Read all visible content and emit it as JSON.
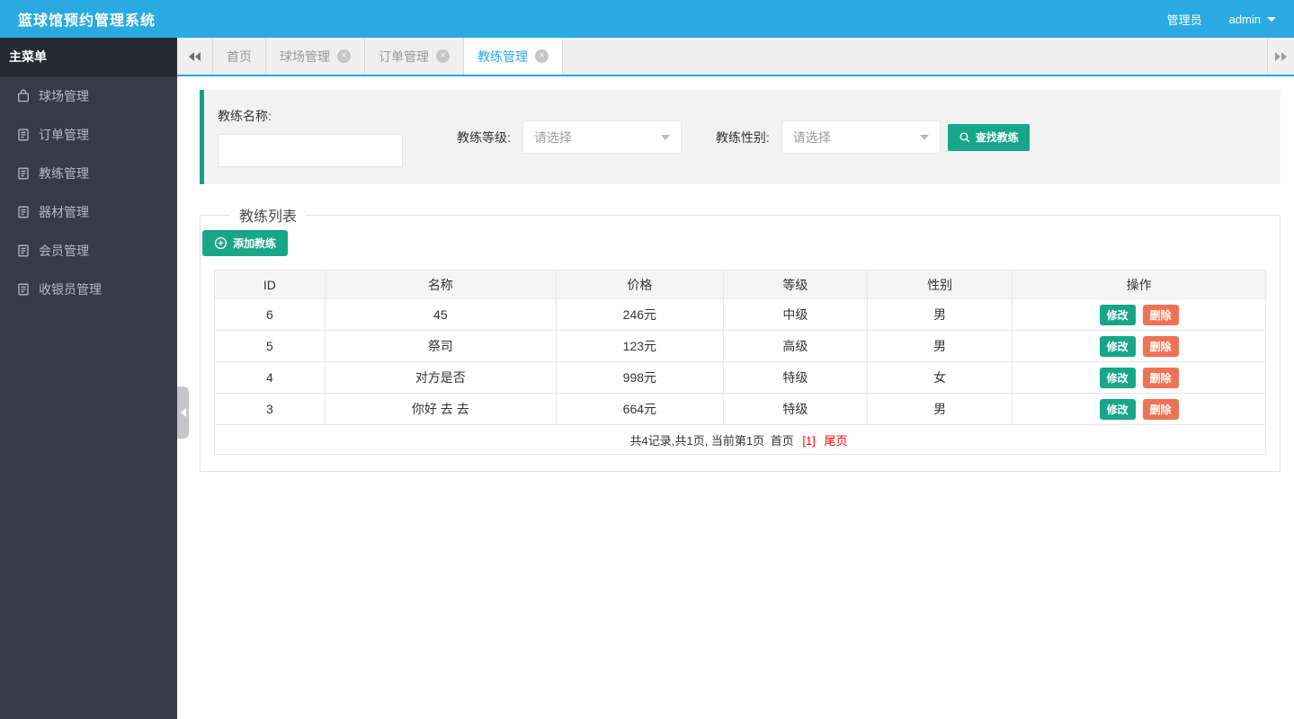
{
  "colors": {
    "accent_blue": "#29abe2",
    "teal_button": "#18a689",
    "teal_accent_bar": "#16a085",
    "orange_delete": "#ee7255",
    "pagination_red": "#ff0000",
    "sidebar_dark": "#373b47"
  },
  "header": {
    "title": "篮球馆预约管理系统",
    "role": "管理员",
    "username": "admin"
  },
  "sidebar": {
    "title": "主菜单",
    "items": [
      {
        "label": "球场管理",
        "icon": "bag-icon"
      },
      {
        "label": "订单管理",
        "icon": "doc-icon"
      },
      {
        "label": "教练管理",
        "icon": "doc-icon"
      },
      {
        "label": "器材管理",
        "icon": "doc-icon"
      },
      {
        "label": "会员管理",
        "icon": "doc-icon"
      },
      {
        "label": "收银员管理",
        "icon": "doc-icon"
      }
    ]
  },
  "tabbar": {
    "tabs": [
      {
        "label": "首页",
        "closable": false,
        "active": false
      },
      {
        "label": "球场管理",
        "closable": true,
        "active": false
      },
      {
        "label": "订单管理",
        "closable": true,
        "active": false
      },
      {
        "label": "教练管理",
        "closable": true,
        "active": true
      }
    ]
  },
  "search": {
    "name_label": "教练名称:",
    "name_value": "",
    "level_label": "教练等级:",
    "level_placeholder": "请选择",
    "gender_label": "教练性别:",
    "gender_placeholder": "请选择",
    "submit_label": "查找教练"
  },
  "coach_list": {
    "legend": "教练列表",
    "add_button_label": "添加教练",
    "table": {
      "columns": [
        "ID",
        "名称",
        "价格",
        "等级",
        "性别",
        "操作"
      ],
      "rows": [
        {
          "id": "6",
          "name": "45",
          "price": "246元",
          "level": "中级",
          "gender": "男"
        },
        {
          "id": "5",
          "name": "祭司",
          "price": "123元",
          "level": "高级",
          "gender": "男"
        },
        {
          "id": "4",
          "name": "对方是否",
          "price": "998元",
          "level": "特级",
          "gender": "女"
        },
        {
          "id": "3",
          "name": "你好 去 去",
          "price": "664元",
          "level": "特级",
          "gender": "男"
        }
      ],
      "edit_label": "修改",
      "delete_label": "删除"
    },
    "pagination": {
      "summary": "共4记录,共1页, 当前第1页",
      "first": "首页",
      "current": "[1]",
      "last": "尾页"
    }
  }
}
